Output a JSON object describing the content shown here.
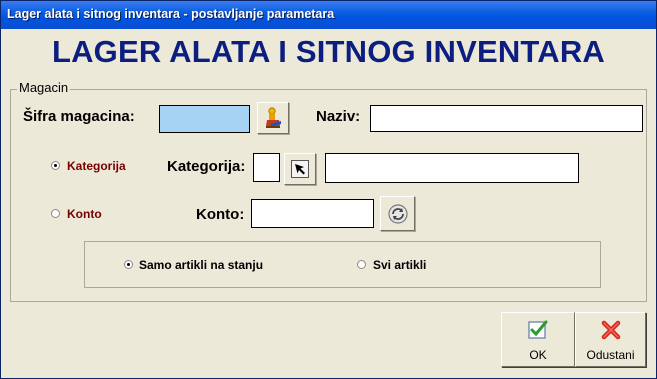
{
  "window": {
    "title": "Lager alata i sitnog inventara - postavljanje parametara"
  },
  "heading": "LAGER ALATA I SITNOG INVENTARA",
  "magacin": {
    "group_label": "Magacin",
    "sifra_label": "Šifra magacina:",
    "sifra_value": "",
    "naziv_label": "Naziv:",
    "naziv_value": ""
  },
  "kategorija": {
    "radio_label": "Kategorija",
    "field_label": "Kategorija:",
    "code_value": "",
    "name_value": ""
  },
  "konto": {
    "radio_label": "Konto",
    "field_label": "Konto:",
    "value": ""
  },
  "filter": {
    "option1": "Samo artikli na stanju",
    "option2": "Svi artikli"
  },
  "buttons": {
    "ok": "OK",
    "cancel": "Odustani"
  },
  "icons": {
    "sifra_lookup": "warehouse-picker-icon",
    "kategorija_lookup": "cursor-arrow-icon",
    "konto_lookup": "refresh-icon",
    "ok": "check-icon",
    "cancel": "red-x-icon"
  },
  "colors": {
    "titlebar": "#0054e3",
    "heading": "#0c1e80",
    "highlight_field": "#a6d2f4",
    "radio_label_red": "#7a0000"
  }
}
